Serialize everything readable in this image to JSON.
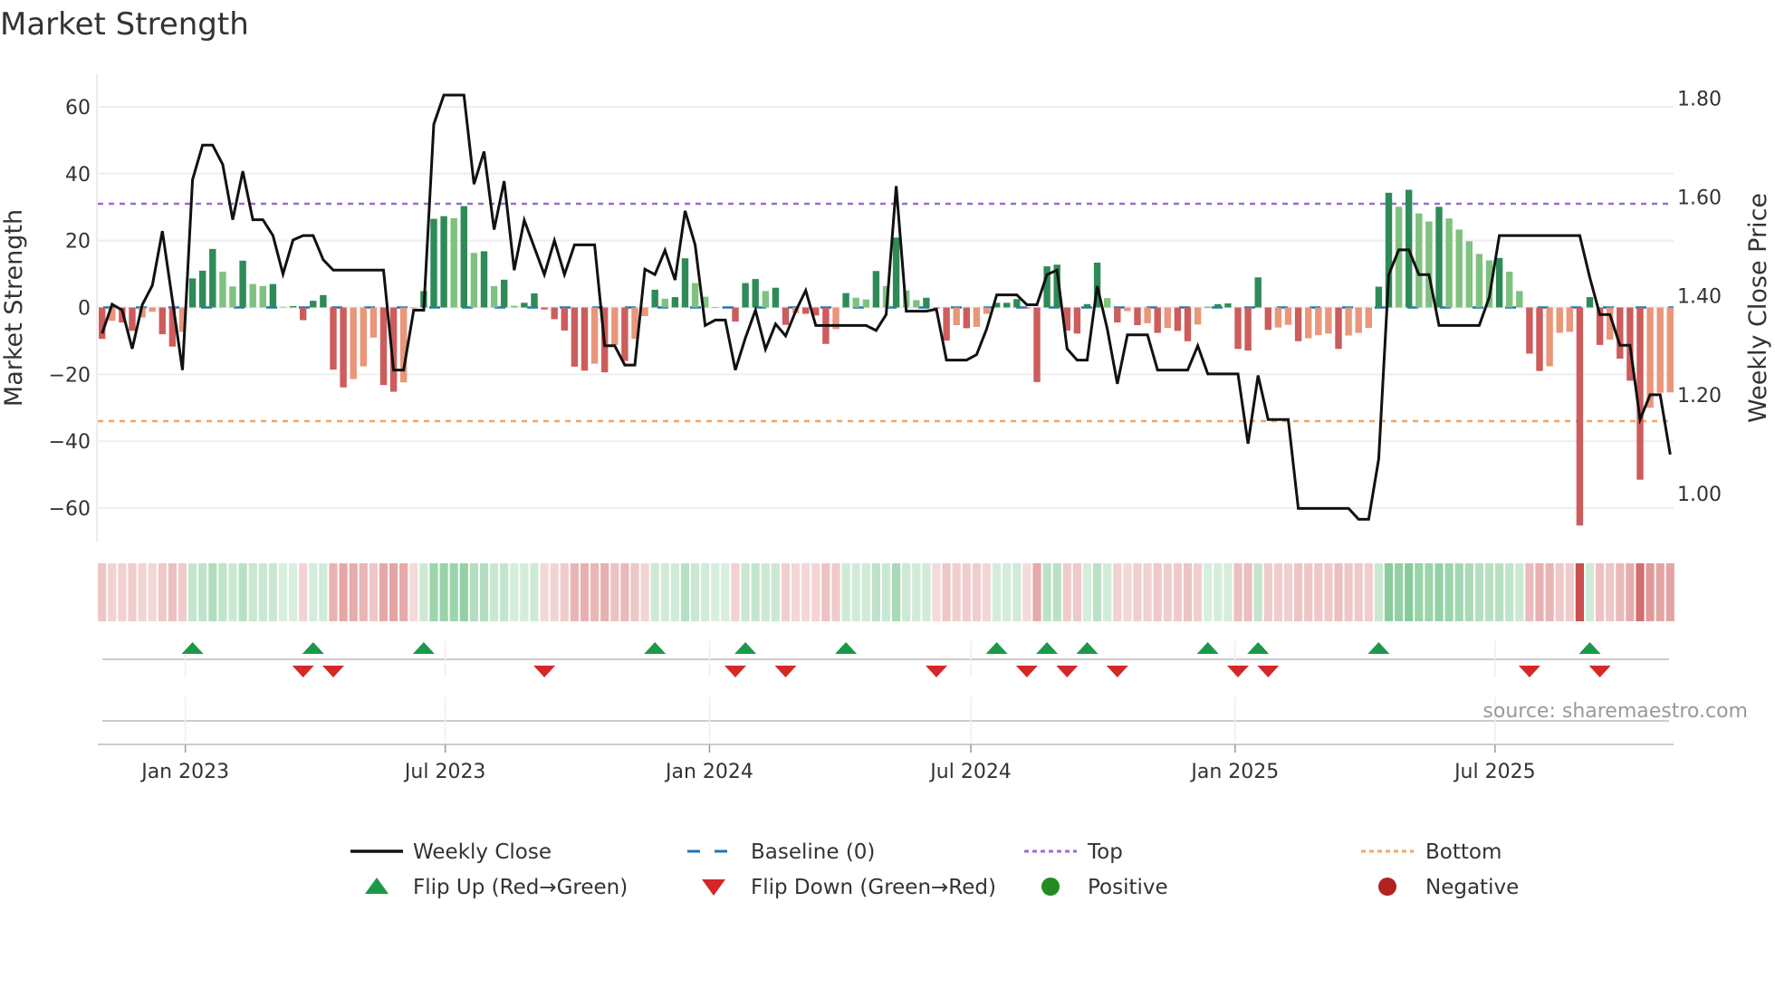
{
  "chart_data": {
    "type": "bar",
    "title": "Market Strength",
    "ylabel": "Market Strength",
    "ylabel_right": "Weekly Close Price",
    "source": "source: sharemaestro.com",
    "start_week": "2022-11-04",
    "frequency": "weekly",
    "ylim": [
      -70,
      70
    ],
    "ylim_right": [
      0.903,
      1.85
    ],
    "yticks": [
      -60,
      -40,
      -20,
      0,
      20,
      40,
      60
    ],
    "yticks_labels": [
      "−60",
      "−40",
      "−20",
      "0",
      "20",
      "40",
      "60"
    ],
    "yticks_right": [
      1.0,
      1.2,
      1.4,
      1.6,
      1.8
    ],
    "yticks_right_labels": [
      "1.00",
      "1.20",
      "1.40",
      "1.60",
      "1.80"
    ],
    "xticks": [
      {
        "date": "2023-01-01",
        "label": "Jan 2023"
      },
      {
        "date": "2023-07-01",
        "label": "Jul 2023"
      },
      {
        "date": "2024-01-01",
        "label": "Jan 2024"
      },
      {
        "date": "2024-07-01",
        "label": "Jul 2024"
      },
      {
        "date": "2025-01-01",
        "label": "Jan 2025"
      },
      {
        "date": "2025-07-01",
        "label": "Jul 2025"
      }
    ],
    "grid": true,
    "top_level": 31,
    "bottom_level": -34,
    "baseline": 0,
    "strength": [
      -9.4,
      -4,
      -4.5,
      -7,
      -3,
      -1.3,
      -8,
      -11.7,
      -7.3,
      8.7,
      11,
      17.5,
      10.7,
      6.3,
      14,
      7,
      6.4,
      7,
      0.2,
      0.4,
      -3.8,
      2,
      3.7,
      -18.6,
      -23.9,
      -21.4,
      -17.6,
      -9,
      -23.2,
      -25.2,
      -22.4,
      -0.3,
      4.9,
      26.5,
      27.3,
      26.7,
      30.3,
      16.3,
      16.8,
      6.4,
      8.3,
      0.5,
      1.4,
      4.2,
      -0.6,
      -3.5,
      -6.9,
      -17.7,
      -18.9,
      -16.8,
      -19.4,
      -11.2,
      -16,
      -9.4,
      -2.6,
      5.3,
      2.6,
      3.1,
      14.7,
      7.3,
      3.2,
      0.1,
      0.1,
      -4.2,
      7.3,
      8.5,
      4.9,
      5.9,
      -5.2,
      -1.7,
      -1.9,
      -2.4,
      -10.9,
      -6.5,
      4.3,
      2.9,
      2.4,
      10.9,
      6.4,
      20.9,
      5.1,
      2.2,
      2.9,
      -0.3,
      -9.9,
      -5.3,
      -6.2,
      -5.8,
      -1.9,
      1.4,
      1.4,
      2.5,
      -0.3,
      -22.3,
      12.3,
      12.8,
      -6.9,
      -7.8,
      1,
      13.4,
      2.8,
      -4.5,
      -1.1,
      -5.3,
      -4.7,
      -7.6,
      -6.1,
      -7,
      -10.1,
      -5.1,
      0.2,
      1,
      1.2,
      -12.4,
      -12.9,
      9,
      -6.7,
      -6,
      -5.2,
      -10.1,
      -9.2,
      -8.3,
      -7.8,
      -12.4,
      -8.4,
      -7.6,
      -6.1,
      6.2,
      34.3,
      30.1,
      35.2,
      28.1,
      25.7,
      30.1,
      26.6,
      23.3,
      19.8,
      16,
      14.1,
      14.8,
      10.7,
      4.9,
      -13.8,
      -19,
      -17.6,
      -7.6,
      -7.3,
      -65.2,
      3.1,
      -11.2,
      -9.6,
      -15.3,
      -21.9,
      -51.5,
      -30,
      -25.5,
      -25.4
    ],
    "weekly_close": [
      1.324,
      1.383,
      1.371,
      1.293,
      1.382,
      1.421,
      1.531,
      1.391,
      1.25,
      1.635,
      1.705,
      1.705,
      1.666,
      1.554,
      1.652,
      1.554,
      1.554,
      1.522,
      1.444,
      1.513,
      1.522,
      1.522,
      1.473,
      1.452,
      1.452,
      1.452,
      1.452,
      1.452,
      1.452,
      1.25,
      1.25,
      1.371,
      1.371,
      1.747,
      1.806,
      1.806,
      1.806,
      1.626,
      1.692,
      1.534,
      1.632,
      1.452,
      1.553,
      1.498,
      1.443,
      1.512,
      1.443,
      1.503,
      1.503,
      1.503,
      1.299,
      1.299,
      1.26,
      1.26,
      1.454,
      1.443,
      1.492,
      1.432,
      1.572,
      1.503,
      1.34,
      1.351,
      1.351,
      1.25,
      1.315,
      1.371,
      1.292,
      1.343,
      1.319,
      1.369,
      1.411,
      1.34,
      1.34,
      1.34,
      1.34,
      1.34,
      1.34,
      1.33,
      1.362,
      1.622,
      1.369,
      1.369,
      1.369,
      1.373,
      1.27,
      1.27,
      1.27,
      1.281,
      1.333,
      1.402,
      1.402,
      1.402,
      1.382,
      1.382,
      1.443,
      1.452,
      1.293,
      1.27,
      1.27,
      1.42,
      1.333,
      1.222,
      1.321,
      1.321,
      1.321,
      1.25,
      1.25,
      1.25,
      1.25,
      1.299,
      1.242,
      1.242,
      1.242,
      1.242,
      1.101,
      1.239,
      1.15,
      1.15,
      1.15,
      0.97,
      0.97,
      0.97,
      0.97,
      0.97,
      0.97,
      0.948,
      0.948,
      1.07,
      1.443,
      1.493,
      1.493,
      1.443,
      1.443,
      1.34,
      1.34,
      1.34,
      1.34,
      1.34,
      1.397,
      1.522,
      1.522,
      1.522,
      1.522,
      1.522,
      1.522,
      1.522,
      1.522,
      1.522,
      1.437,
      1.362,
      1.362,
      1.3,
      1.3,
      1.15,
      1.2,
      1.2,
      1.079
    ],
    "flip_up_weeks": [
      10,
      22,
      33,
      56,
      65,
      75,
      90,
      95,
      99,
      111,
      116,
      128,
      149
    ],
    "flip_down_weeks": [
      21,
      24,
      45,
      64,
      69,
      84,
      93,
      97,
      102,
      114,
      117,
      143,
      150
    ],
    "legend": {
      "placement": "bottom",
      "items": [
        {
          "label": "Weekly Close",
          "symbol": "line",
          "color": "#111111"
        },
        {
          "label": "Baseline (0)",
          "symbol": "dashed",
          "color": "#1f77b4"
        },
        {
          "label": "Top",
          "symbol": "dotted",
          "color": "#9b6ad8"
        },
        {
          "label": "Bottom",
          "symbol": "dotted",
          "color": "#f4a460"
        },
        {
          "label": "Flip Up (Red→Green)",
          "symbol": "triangle-up",
          "color": "#1a9a48"
        },
        {
          "label": "Flip Down (Green→Red)",
          "symbol": "triangle-down",
          "color": "#d62728"
        },
        {
          "label": "Positive",
          "symbol": "circle",
          "color": "#228b22"
        },
        {
          "label": "Negative",
          "symbol": "circle",
          "color": "#b22222"
        }
      ]
    },
    "colors": {
      "pos_strong": "#2e8b57",
      "pos_weak": "#7fc17f",
      "neg_strong": "#cd5c5c",
      "neg_weak": "#e9967a",
      "grid": "#eeeeee"
    }
  }
}
